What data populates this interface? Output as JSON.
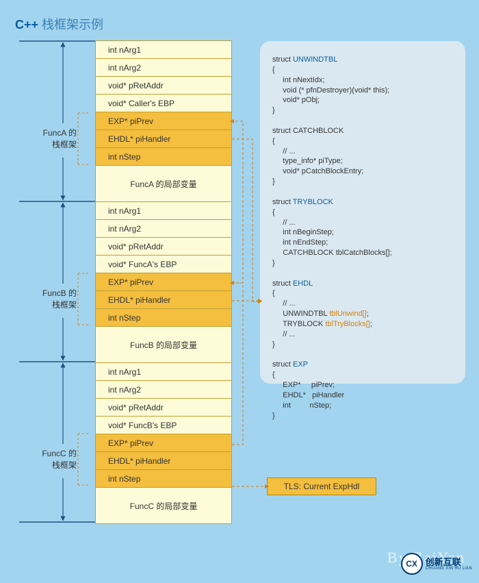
{
  "title_prefix": "C++",
  "title_suffix": " 栈框架示例",
  "frames": [
    {
      "label": "FuncA 的\n栈框架",
      "rows": [
        {
          "text": "int nArg1",
          "cls": "pale"
        },
        {
          "text": "int nArg2",
          "cls": "pale"
        },
        {
          "text": "void* pRetAddr",
          "cls": "pale"
        },
        {
          "text": "void* Caller's EBP",
          "cls": "pale"
        },
        {
          "text": "EXP* piPrev",
          "cls": "gold"
        },
        {
          "text": "EHDL* piHandler",
          "cls": "gold"
        },
        {
          "text": "int nStep",
          "cls": "gold"
        },
        {
          "text": "FuncA 的局部变量",
          "cls": "pale big"
        }
      ]
    },
    {
      "label": "FuncB 的\n栈框架",
      "rows": [
        {
          "text": "int nArg1",
          "cls": "pale"
        },
        {
          "text": "int nArg2",
          "cls": "pale"
        },
        {
          "text": "void* pRetAddr",
          "cls": "pale"
        },
        {
          "text": "void* FuncA's EBP",
          "cls": "pale"
        },
        {
          "text": "EXP* piPrev",
          "cls": "gold"
        },
        {
          "text": "EHDL* piHandler",
          "cls": "gold"
        },
        {
          "text": "int nStep",
          "cls": "gold"
        },
        {
          "text": "FuncB 的局部变量",
          "cls": "pale big"
        }
      ]
    },
    {
      "label": "FuncC 的\n栈框架",
      "rows": [
        {
          "text": "int nArg1",
          "cls": "pale"
        },
        {
          "text": "int nArg2",
          "cls": "pale"
        },
        {
          "text": "void* pRetAddr",
          "cls": "pale"
        },
        {
          "text": "void* FuncB's EBP",
          "cls": "pale"
        },
        {
          "text": "EXP* piPrev",
          "cls": "gold"
        },
        {
          "text": "EHDL* piHandler",
          "cls": "gold"
        },
        {
          "text": "int nStep",
          "cls": "gold"
        },
        {
          "text": "FuncC 的局部变量",
          "cls": "pale big"
        }
      ]
    }
  ],
  "code": {
    "s1_kw": "UNWINDTBL",
    "s1": "struct ",
    "s1b": "\n{\n     int nNextIdx;\n     void (* pfnDestroyer)(void* this);\n     void* pObj;\n}\n\n",
    "s2": "struct CATCHBLOCK\n{\n     // ...\n     type_info* piType;\n     void* pCatchBlockEntry;\n}\n\n",
    "s3_kw": "TRYBLOCK",
    "s3": "struct ",
    "s3b": "\n{\n     // ...\n     int nBeginStep;\n     int nEndStep;\n     CATCHBLOCK tblCatchBlocks[];\n}\n\n",
    "s4_kw": "EHDL",
    "s4": "struct ",
    "s4b": "\n{\n     // ...\n     UNWINDTBL ",
    "s4_arr1": "tblUnwind[]",
    "s4c": ";\n     TRYBLOCK ",
    "s4_arr2": "tblTryBlocks[]",
    "s4d": ";\n     // ...\n}\n\n",
    "s5_kw": "EXP",
    "s5": "struct ",
    "s5b": "\n{\n     EXP*     piPrev;\n     EHDL*   piHandler\n     int         nStep;\n}"
  },
  "tls_label": "TLS: Current ExpHdl",
  "byline": "By BaiYan",
  "logo_mark": "CX",
  "logo_cn": "创新互联",
  "logo_en": "CHUANG XIN HU LIAN"
}
